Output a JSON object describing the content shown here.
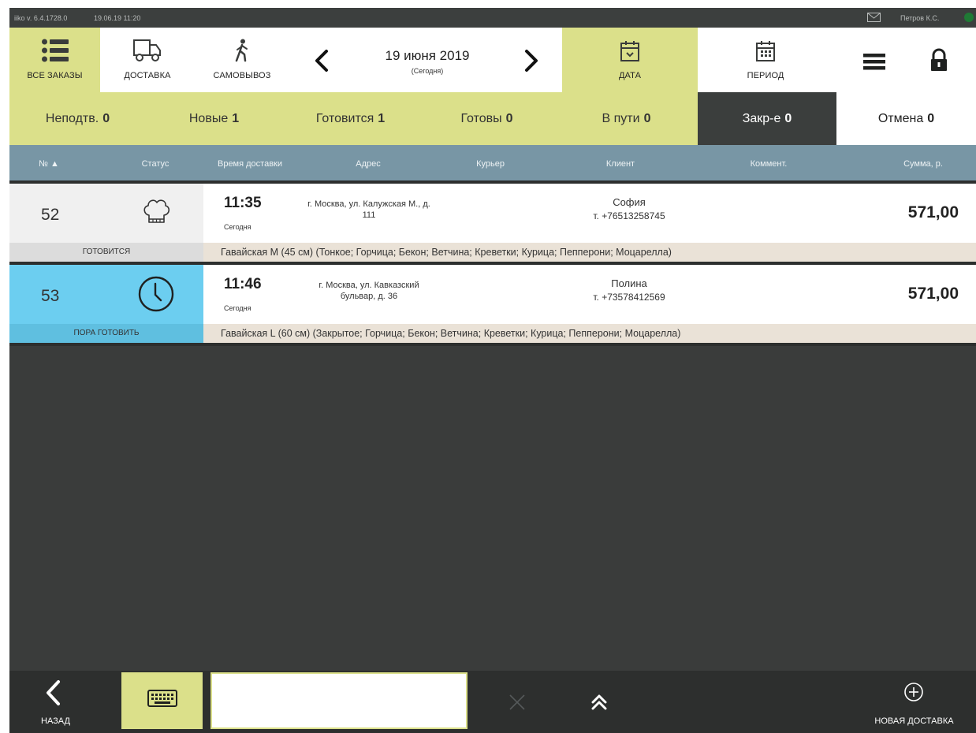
{
  "titlebar": {
    "version": "iiko v. 6.4.1728.0",
    "datetime": "19.06.19 11:20",
    "user": "Петров К.С."
  },
  "toolbar": {
    "all_orders": "ВСЕ ЗАКАЗЫ",
    "delivery": "ДОСТАВКА",
    "pickup": "САМОВЫВОЗ",
    "date_title": "19 июня 2019",
    "date_sub": "(Сегодня)",
    "date": "ДАТА",
    "period": "ПЕРИОД"
  },
  "tabs": [
    {
      "label": "Неподтв.",
      "count": "0"
    },
    {
      "label": "Новые",
      "count": "1"
    },
    {
      "label": "Готовится",
      "count": "1"
    },
    {
      "label": "Готовы",
      "count": "0"
    },
    {
      "label": "В пути",
      "count": "0"
    },
    {
      "label": "Закр-е",
      "count": "0"
    },
    {
      "label": "Отмена",
      "count": "0"
    }
  ],
  "columns": {
    "num": "№",
    "status": "Статус",
    "time": "Время доставки",
    "address": "Адрес",
    "courier": "Курьер",
    "client": "Клиент",
    "comment": "Коммент.",
    "sum": "Сумма, р."
  },
  "orders": [
    {
      "num": "52",
      "status": "ГОТОВИТСЯ",
      "status_icon": "chef-hat-icon",
      "time": "11:35",
      "day": "Сегодня",
      "address_line1": "г. Москва, ул. Калужская М., д.",
      "address_line2": "111",
      "client_name": "София",
      "client_phone": "т. +76513258745",
      "sum": "571,00",
      "items": "Гавайская M (45 см) (Тонкое; Горчица; Бекон; Ветчина; Креветки; Курица; Пепперони; Моцарелла)",
      "num_bg": "#f0f0f0",
      "label_bg": "#dcdcdc"
    },
    {
      "num": "53",
      "status": "ПОРА ГОТОВИТЬ",
      "status_icon": "clock-icon",
      "time": "11:46",
      "day": "Сегодня",
      "address_line1": "г. Москва, ул. Кавказский",
      "address_line2": "бульвар, д. 36",
      "client_name": "Полина",
      "client_phone": "т. +73578412569",
      "sum": "571,00",
      "items": "Гавайская L (60 см) (Закрытое; Горчица; Бекон; Ветчина; Креветки; Курица; Пепперони; Моцарелла)",
      "num_bg": "#6ccef0",
      "label_bg": "#5fbfe0"
    }
  ],
  "bottom": {
    "back": "НАЗАД",
    "new_delivery": "НОВАЯ ДОСТАВКА",
    "search_value": ""
  },
  "colors": {
    "accent": "#dbe08a",
    "header": "#7896a5",
    "dark": "#3b3e3d",
    "due_blue": "#6ccef0"
  }
}
